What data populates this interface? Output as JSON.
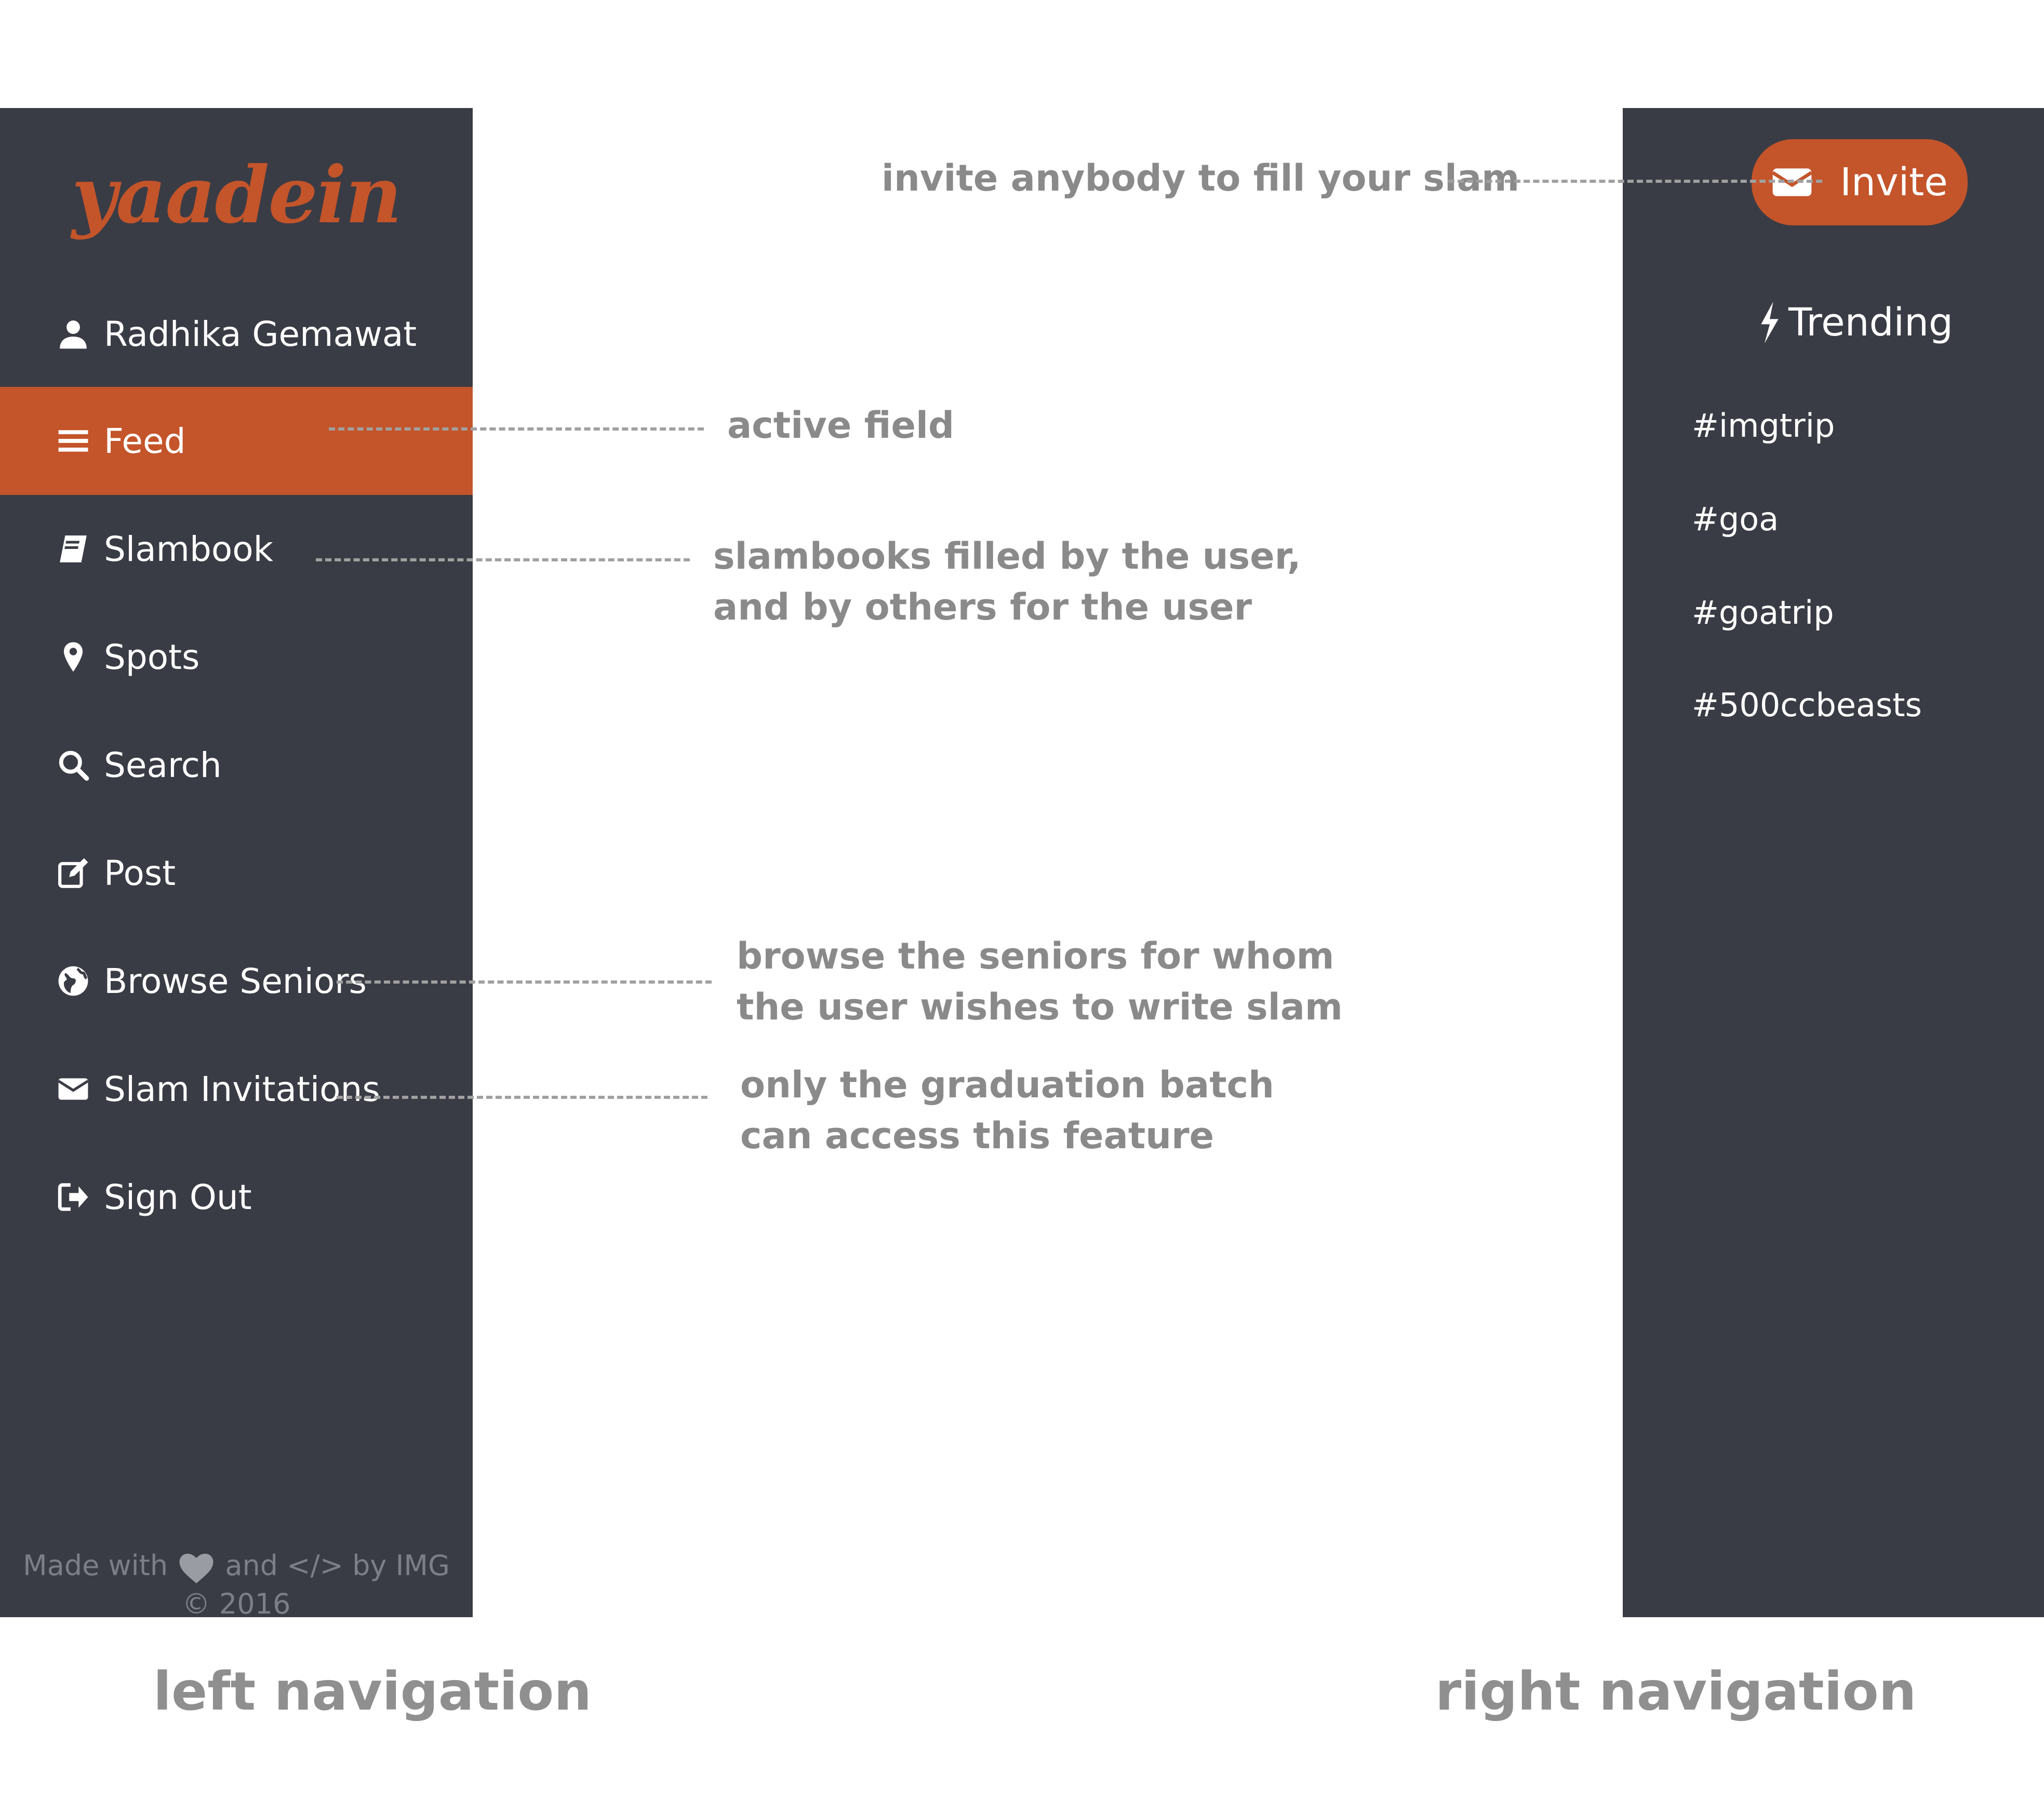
{
  "colors": {
    "sidebar_bg": "#3a3c45",
    "accent": "#c4542a",
    "annotation": "#8a8a8a"
  },
  "left_nav": {
    "logo": "yaadein",
    "items": [
      {
        "label": "Radhika Gemawat",
        "icon": "user-icon"
      },
      {
        "label": "Feed",
        "icon": "menu-icon",
        "active": true
      },
      {
        "label": "Slambook",
        "icon": "book-icon"
      },
      {
        "label": "Spots",
        "icon": "map-marker-icon"
      },
      {
        "label": "Search",
        "icon": "search-icon"
      },
      {
        "label": "Post",
        "icon": "edit-icon"
      },
      {
        "label": "Browse Seniors",
        "icon": "globe-icon"
      },
      {
        "label": "Slam Invitations",
        "icon": "envelope-icon"
      },
      {
        "label": "Sign Out",
        "icon": "sign-out-icon"
      }
    ],
    "footer": {
      "made_with": "Made with",
      "and": "and",
      "code": "</>",
      "by": "by IMG",
      "copyright": "© 2016"
    }
  },
  "right_nav": {
    "invite_label": "Invite",
    "trending_label": "Trending",
    "hashtags": [
      "#imgtrip",
      "#goa",
      "#goatrip",
      "#500ccbeasts"
    ]
  },
  "annotations": {
    "invite": "invite anybody to fill your slam",
    "active": "active field",
    "slambook": [
      "slambooks filled by the user,",
      "and by others for the user"
    ],
    "browse": [
      "browse the seniors for whom",
      "the user wishes to write slam"
    ],
    "invitations": [
      "only the graduation batch",
      "can access this feature"
    ]
  },
  "section_labels": {
    "left": "left navigation",
    "right": "right navigation"
  }
}
